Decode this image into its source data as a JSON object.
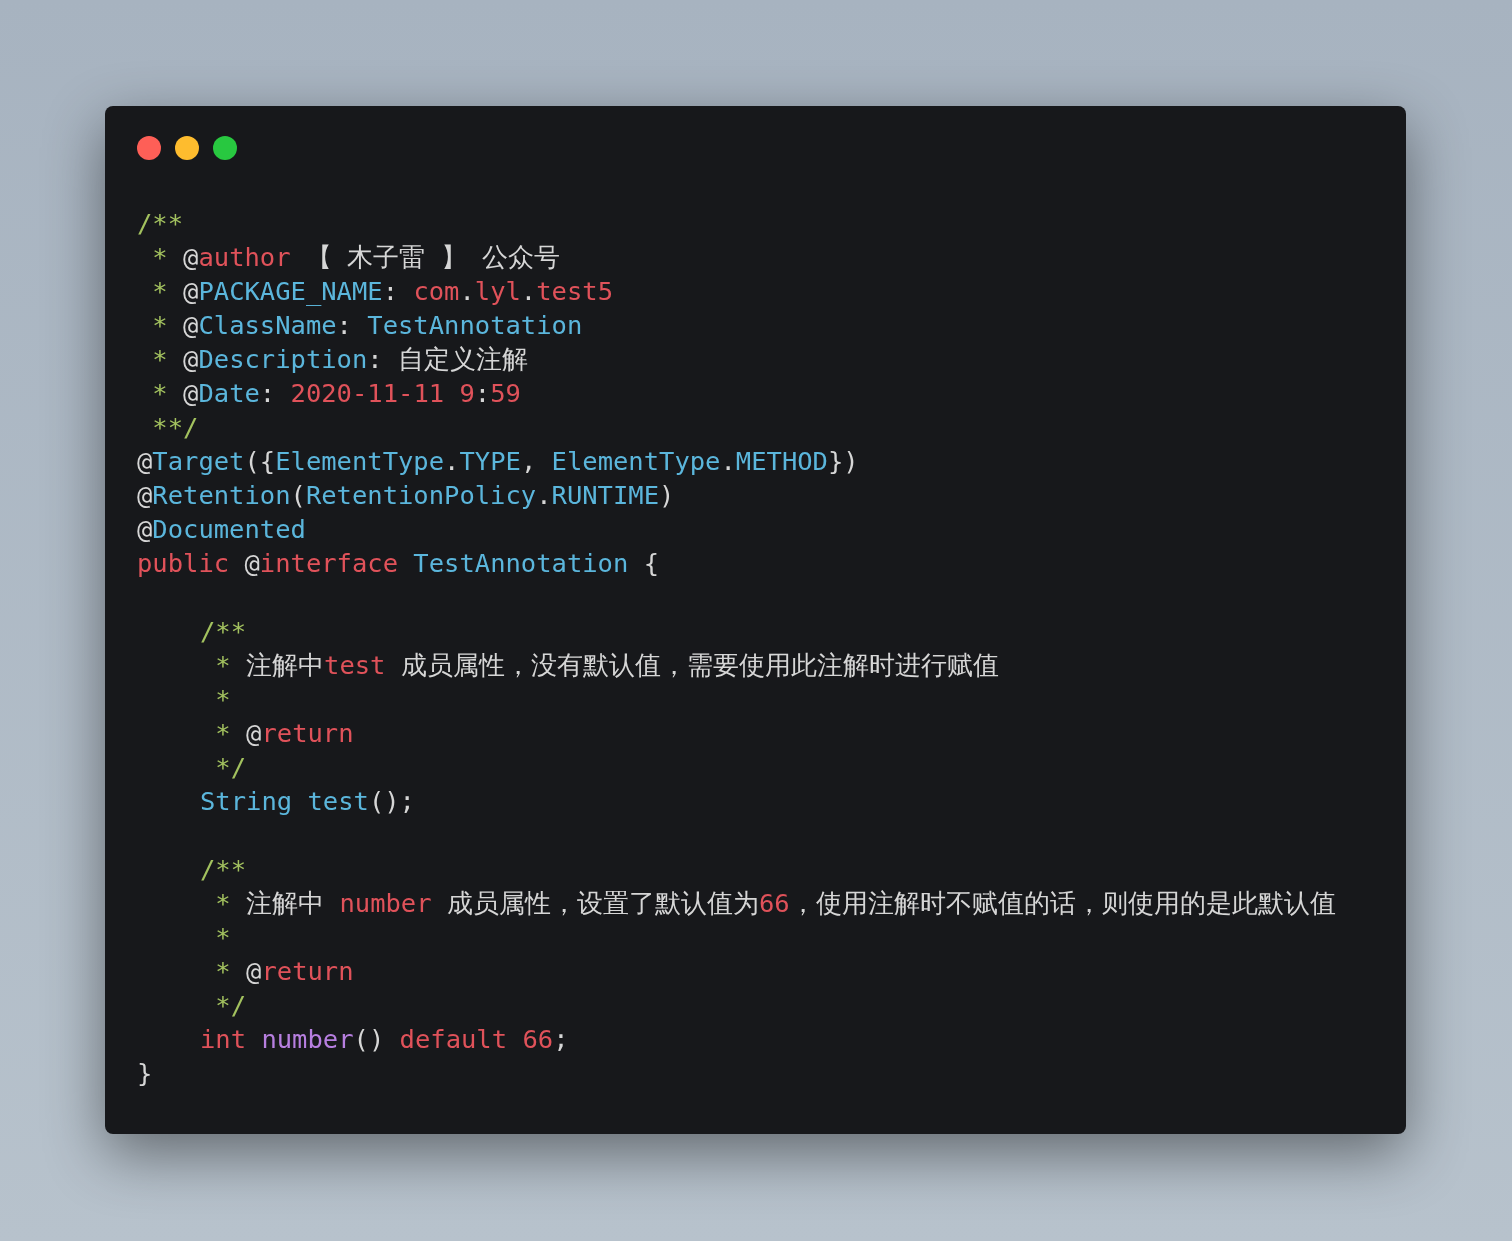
{
  "lines": [
    {
      "tokens": [
        {
          "kind": "comment",
          "text": "/**"
        }
      ]
    },
    {
      "tokens": [
        {
          "kind": "comment",
          "text": " * "
        },
        {
          "kind": "plain",
          "text": "@"
        },
        {
          "kind": "keyword",
          "text": "author"
        },
        {
          "kind": "plain",
          "text": " 【 木子雷 】 公众号"
        }
      ]
    },
    {
      "tokens": [
        {
          "kind": "comment",
          "text": " * "
        },
        {
          "kind": "plain",
          "text": "@"
        },
        {
          "kind": "type",
          "text": "PACKAGE_NAME"
        },
        {
          "kind": "plain",
          "text": ": "
        },
        {
          "kind": "keyword",
          "text": "com"
        },
        {
          "kind": "plain",
          "text": "."
        },
        {
          "kind": "keyword",
          "text": "lyl"
        },
        {
          "kind": "plain",
          "text": "."
        },
        {
          "kind": "keyword",
          "text": "test5"
        }
      ]
    },
    {
      "tokens": [
        {
          "kind": "comment",
          "text": " * "
        },
        {
          "kind": "plain",
          "text": "@"
        },
        {
          "kind": "type",
          "text": "ClassName"
        },
        {
          "kind": "plain",
          "text": ": "
        },
        {
          "kind": "type",
          "text": "TestAnnotation"
        }
      ]
    },
    {
      "tokens": [
        {
          "kind": "comment",
          "text": " * "
        },
        {
          "kind": "plain",
          "text": "@"
        },
        {
          "kind": "type",
          "text": "Description"
        },
        {
          "kind": "plain",
          "text": ": 自定义注解"
        }
      ]
    },
    {
      "tokens": [
        {
          "kind": "comment",
          "text": " * "
        },
        {
          "kind": "plain",
          "text": "@"
        },
        {
          "kind": "type",
          "text": "Date"
        },
        {
          "kind": "plain",
          "text": ": "
        },
        {
          "kind": "keyword",
          "text": "2020-11-11 9"
        },
        {
          "kind": "plain",
          "text": ":"
        },
        {
          "kind": "keyword",
          "text": "59"
        }
      ]
    },
    {
      "tokens": [
        {
          "kind": "comment",
          "text": " **/"
        }
      ]
    },
    {
      "tokens": [
        {
          "kind": "plain",
          "text": "@"
        },
        {
          "kind": "type",
          "text": "Target"
        },
        {
          "kind": "plain",
          "text": "({"
        },
        {
          "kind": "type",
          "text": "ElementType"
        },
        {
          "kind": "plain",
          "text": "."
        },
        {
          "kind": "type",
          "text": "TYPE"
        },
        {
          "kind": "plain",
          "text": ", "
        },
        {
          "kind": "type",
          "text": "ElementType"
        },
        {
          "kind": "plain",
          "text": "."
        },
        {
          "kind": "type",
          "text": "METHOD"
        },
        {
          "kind": "plain",
          "text": "})"
        }
      ]
    },
    {
      "tokens": [
        {
          "kind": "plain",
          "text": "@"
        },
        {
          "kind": "type",
          "text": "Retention"
        },
        {
          "kind": "plain",
          "text": "("
        },
        {
          "kind": "type",
          "text": "RetentionPolicy"
        },
        {
          "kind": "plain",
          "text": "."
        },
        {
          "kind": "type",
          "text": "RUNTIME"
        },
        {
          "kind": "plain",
          "text": ")"
        }
      ]
    },
    {
      "tokens": [
        {
          "kind": "plain",
          "text": "@"
        },
        {
          "kind": "type",
          "text": "Documented"
        }
      ]
    },
    {
      "tokens": [
        {
          "kind": "keyword",
          "text": "public"
        },
        {
          "kind": "plain",
          "text": " @"
        },
        {
          "kind": "keyword",
          "text": "interface"
        },
        {
          "kind": "type",
          "text": " TestAnnotation"
        },
        {
          "kind": "plain",
          "text": " {"
        }
      ],
      "children": [
        {
          "lines": [
            {
              "tokens": [
                {
                  "kind": "comment",
                  "text": "/**"
                }
              ]
            },
            {
              "tokens": [
                {
                  "kind": "comment",
                  "text": " * "
                },
                {
                  "kind": "plain",
                  "text": "注解中"
                },
                {
                  "kind": "keyword",
                  "text": "test"
                },
                {
                  "kind": "plain",
                  "text": " 成员属性，没有默认值，需要使用此注解时进行赋值"
                }
              ]
            },
            {
              "tokens": [
                {
                  "kind": "comment",
                  "text": " *"
                }
              ]
            },
            {
              "tokens": [
                {
                  "kind": "comment",
                  "text": " * "
                },
                {
                  "kind": "plain",
                  "text": "@"
                },
                {
                  "kind": "keyword",
                  "text": "return"
                }
              ]
            },
            {
              "tokens": [
                {
                  "kind": "comment",
                  "text": " */"
                }
              ]
            },
            {
              "tokens": [
                {
                  "kind": "type",
                  "text": "String"
                },
                {
                  "kind": "type",
                  "text": " test"
                },
                {
                  "kind": "plain",
                  "text": "();"
                }
              ]
            }
          ]
        },
        {
          "lines": [
            {
              "tokens": [
                {
                  "kind": "comment",
                  "text": "/**"
                }
              ]
            },
            {
              "tokens": [
                {
                  "kind": "comment",
                  "text": " * "
                },
                {
                  "kind": "plain",
                  "text": "注解中 "
                },
                {
                  "kind": "keyword",
                  "text": "number"
                },
                {
                  "kind": "plain",
                  "text": " 成员属性，设置了默认值为"
                },
                {
                  "kind": "keyword",
                  "text": "66"
                },
                {
                  "kind": "plain",
                  "text": "，使用注解时不赋值的话，则使用的是此默认值"
                }
              ]
            },
            {
              "tokens": [
                {
                  "kind": "comment",
                  "text": " *"
                }
              ]
            },
            {
              "tokens": [
                {
                  "kind": "comment",
                  "text": " * "
                },
                {
                  "kind": "plain",
                  "text": "@"
                },
                {
                  "kind": "keyword",
                  "text": "return"
                }
              ]
            },
            {
              "tokens": [
                {
                  "kind": "comment",
                  "text": " */"
                }
              ]
            },
            {
              "tokens": [
                {
                  "kind": "keyword",
                  "text": "int"
                },
                {
                  "kind": "function",
                  "text": " number"
                },
                {
                  "kind": "plain",
                  "text": "() "
                },
                {
                  "kind": "keyword",
                  "text": "default"
                },
                {
                  "kind": "keyword",
                  "text": " 66"
                },
                {
                  "kind": "plain",
                  "text": ";"
                }
              ]
            }
          ]
        }
      ]
    },
    {
      "tokens": [
        {
          "kind": "plain",
          "text": "}"
        }
      ]
    }
  ]
}
